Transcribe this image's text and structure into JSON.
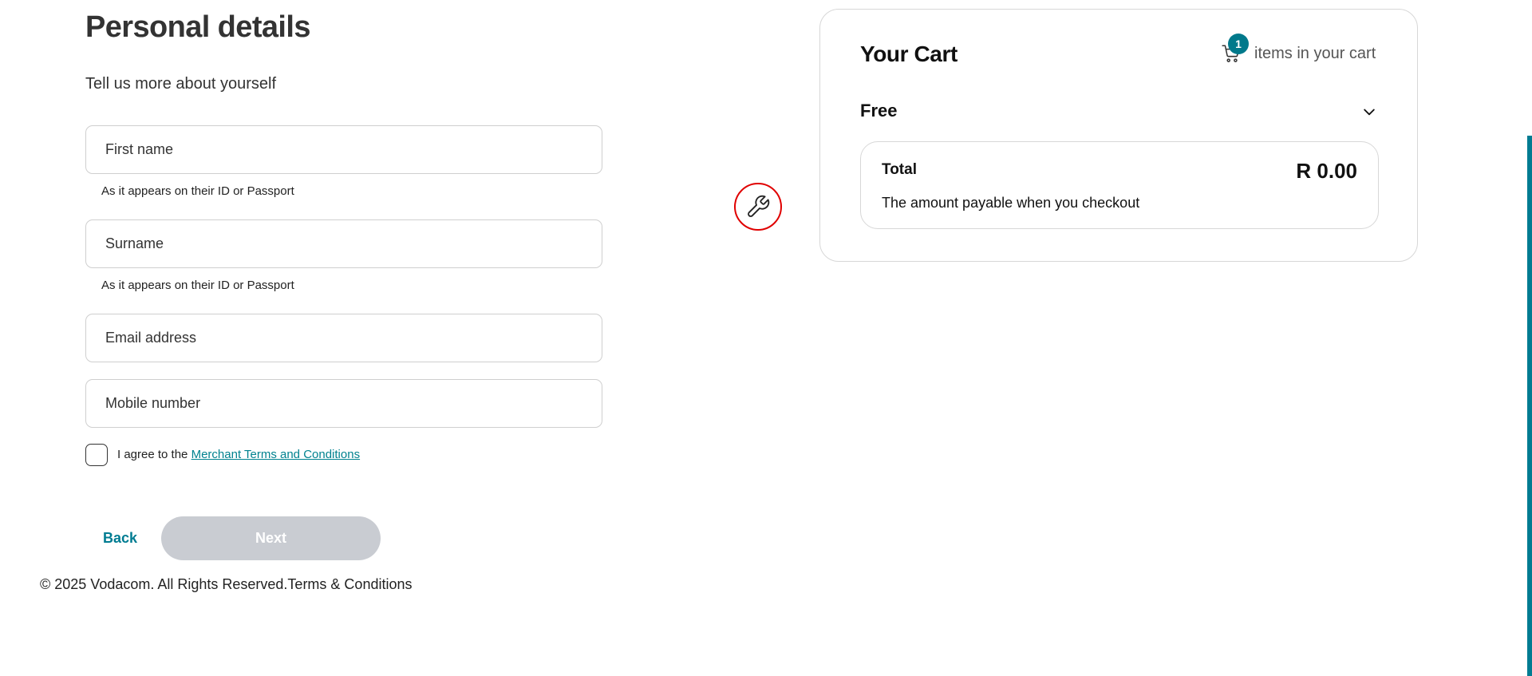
{
  "form": {
    "title": "Personal details",
    "subtitle": "Tell us more about yourself",
    "first_name_placeholder": "First name",
    "first_name_hint": "As it appears on their ID or Passport",
    "surname_placeholder": "Surname",
    "surname_hint": "As it appears on their ID or Passport",
    "email_placeholder": "Email address",
    "mobile_placeholder": "Mobile number",
    "agree_prefix": "I agree to the ",
    "agree_link": "Merchant Terms and Conditions",
    "back_label": "Back",
    "next_label": "Next"
  },
  "footer": {
    "text": "© 2025 Vodacom. All Rights Reserved.Terms & Conditions"
  },
  "cart": {
    "title": "Your Cart",
    "count": "1",
    "items_label": "items in your cart",
    "plan_name": "Free",
    "total_label": "Total",
    "total_amount": "R 0.00",
    "total_desc": "The amount payable when you checkout"
  },
  "icons": {
    "tool": "wrench-icon",
    "cart": "cart-icon",
    "expand": "chevron-down-icon"
  },
  "colors": {
    "accent": "#007c92",
    "badge": "#00798b",
    "disabled_button": "#c9ccd2",
    "tool_ring": "#e00000"
  }
}
